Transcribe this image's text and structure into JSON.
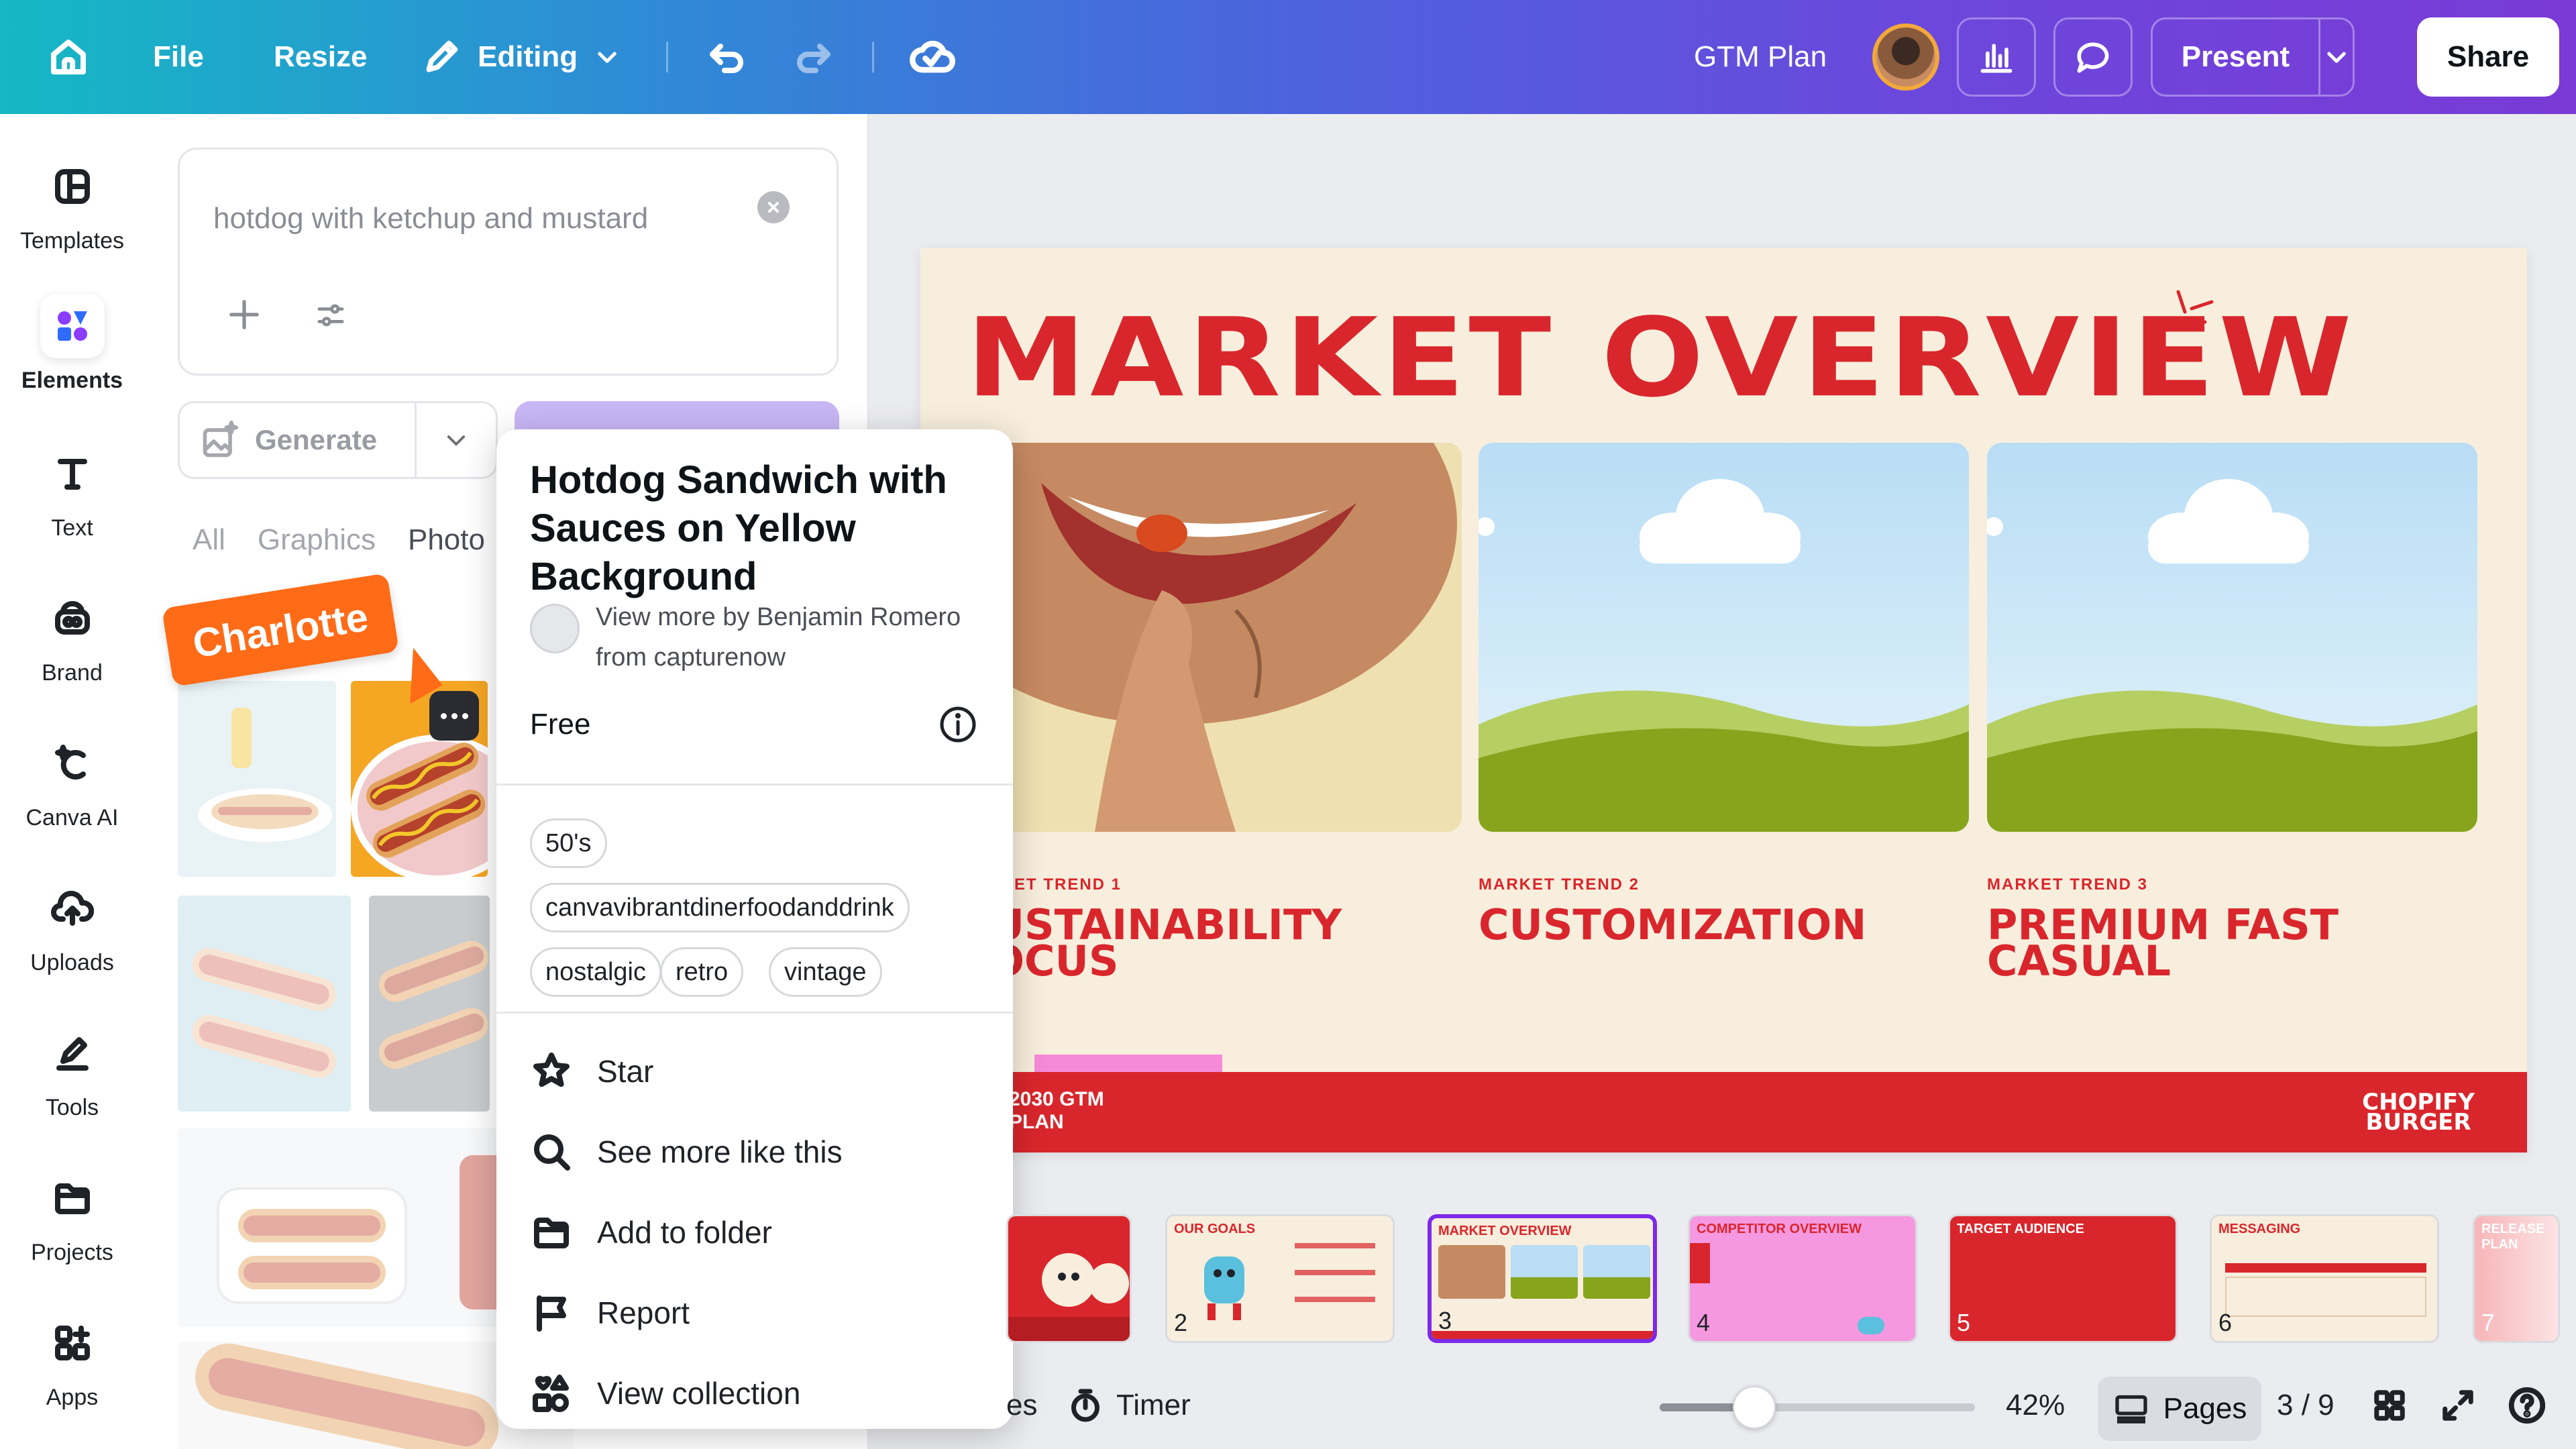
{
  "topbar": {
    "file": "File",
    "resize": "Resize",
    "editing": "Editing",
    "doc_title": "GTM Plan",
    "present": "Present",
    "share": "Share",
    "icons": [
      "home-icon",
      "pencil-icon",
      "chevron-down-icon",
      "undo-icon",
      "redo-icon",
      "cloud-check-icon",
      "chart-icon",
      "comment-icon"
    ]
  },
  "rail": {
    "items": [
      {
        "label": "Templates",
        "icon": "templates-icon"
      },
      {
        "label": "Elements",
        "icon": "elements-icon",
        "active": true
      },
      {
        "label": "Text",
        "icon": "text-icon"
      },
      {
        "label": "Brand",
        "icon": "brand-icon"
      },
      {
        "label": "Canva AI",
        "icon": "canva-ai-icon"
      },
      {
        "label": "Uploads",
        "icon": "uploads-icon"
      },
      {
        "label": "Tools",
        "icon": "tools-icon"
      },
      {
        "label": "Projects",
        "icon": "folder-icon"
      },
      {
        "label": "Apps",
        "icon": "apps-icon"
      }
    ]
  },
  "panel": {
    "search_value": "hotdog with ketchup and mustard",
    "generate": "Generate",
    "tabs": [
      "All",
      "Graphics",
      "Photo"
    ],
    "collaborator": "Charlotte"
  },
  "popup": {
    "title": "Hotdog Sandwich with Sauces on Yellow Background",
    "by": "View more by Benjamin Romero from capturenow",
    "license": "Free",
    "tags": [
      "50's",
      "canvavibrantdinerfoodanddrink",
      "nostalgic",
      "retro",
      "vintage"
    ],
    "menu": [
      "Star",
      "See more like this",
      "Add to folder",
      "Report",
      "View collection"
    ]
  },
  "slide": {
    "title": "MARKET OVERVIEW",
    "trends": [
      {
        "label": "MARKET TREND 1",
        "title": "SUSTAINABILITY FOCUS"
      },
      {
        "label": "MARKET TREND 2",
        "title": "CUSTOMIZATION"
      },
      {
        "label": "MARKET TREND 3",
        "title": "PREMIUM FAST CASUAL"
      }
    ],
    "footer_left": "2030 GTM PLAN",
    "footer_right": "CHOPIFY BURGER"
  },
  "filmstrip": [
    {
      "num": "",
      "head": ""
    },
    {
      "num": "2",
      "head": "OUR GOALS"
    },
    {
      "num": "3",
      "head": "MARKET OVERVIEW",
      "active": true
    },
    {
      "num": "4",
      "head": "COMPETITOR OVERVIEW"
    },
    {
      "num": "5",
      "head": "TARGET AUDIENCE"
    },
    {
      "num": "6",
      "head": "MESSAGING"
    },
    {
      "num": "7",
      "head": "RELEASE PLAN"
    }
  ],
  "bottombar": {
    "notes_fragment": "es",
    "timer": "Timer",
    "zoom": "42%",
    "zoom_fraction": 0.42,
    "pages": "Pages",
    "page_count": "3 / 9"
  },
  "colors": {
    "brand_red": "#d9262c",
    "slide_bg": "#f8eedd",
    "accent_purple": "#7d2ae8",
    "collab_orange": "#ff6b17"
  }
}
